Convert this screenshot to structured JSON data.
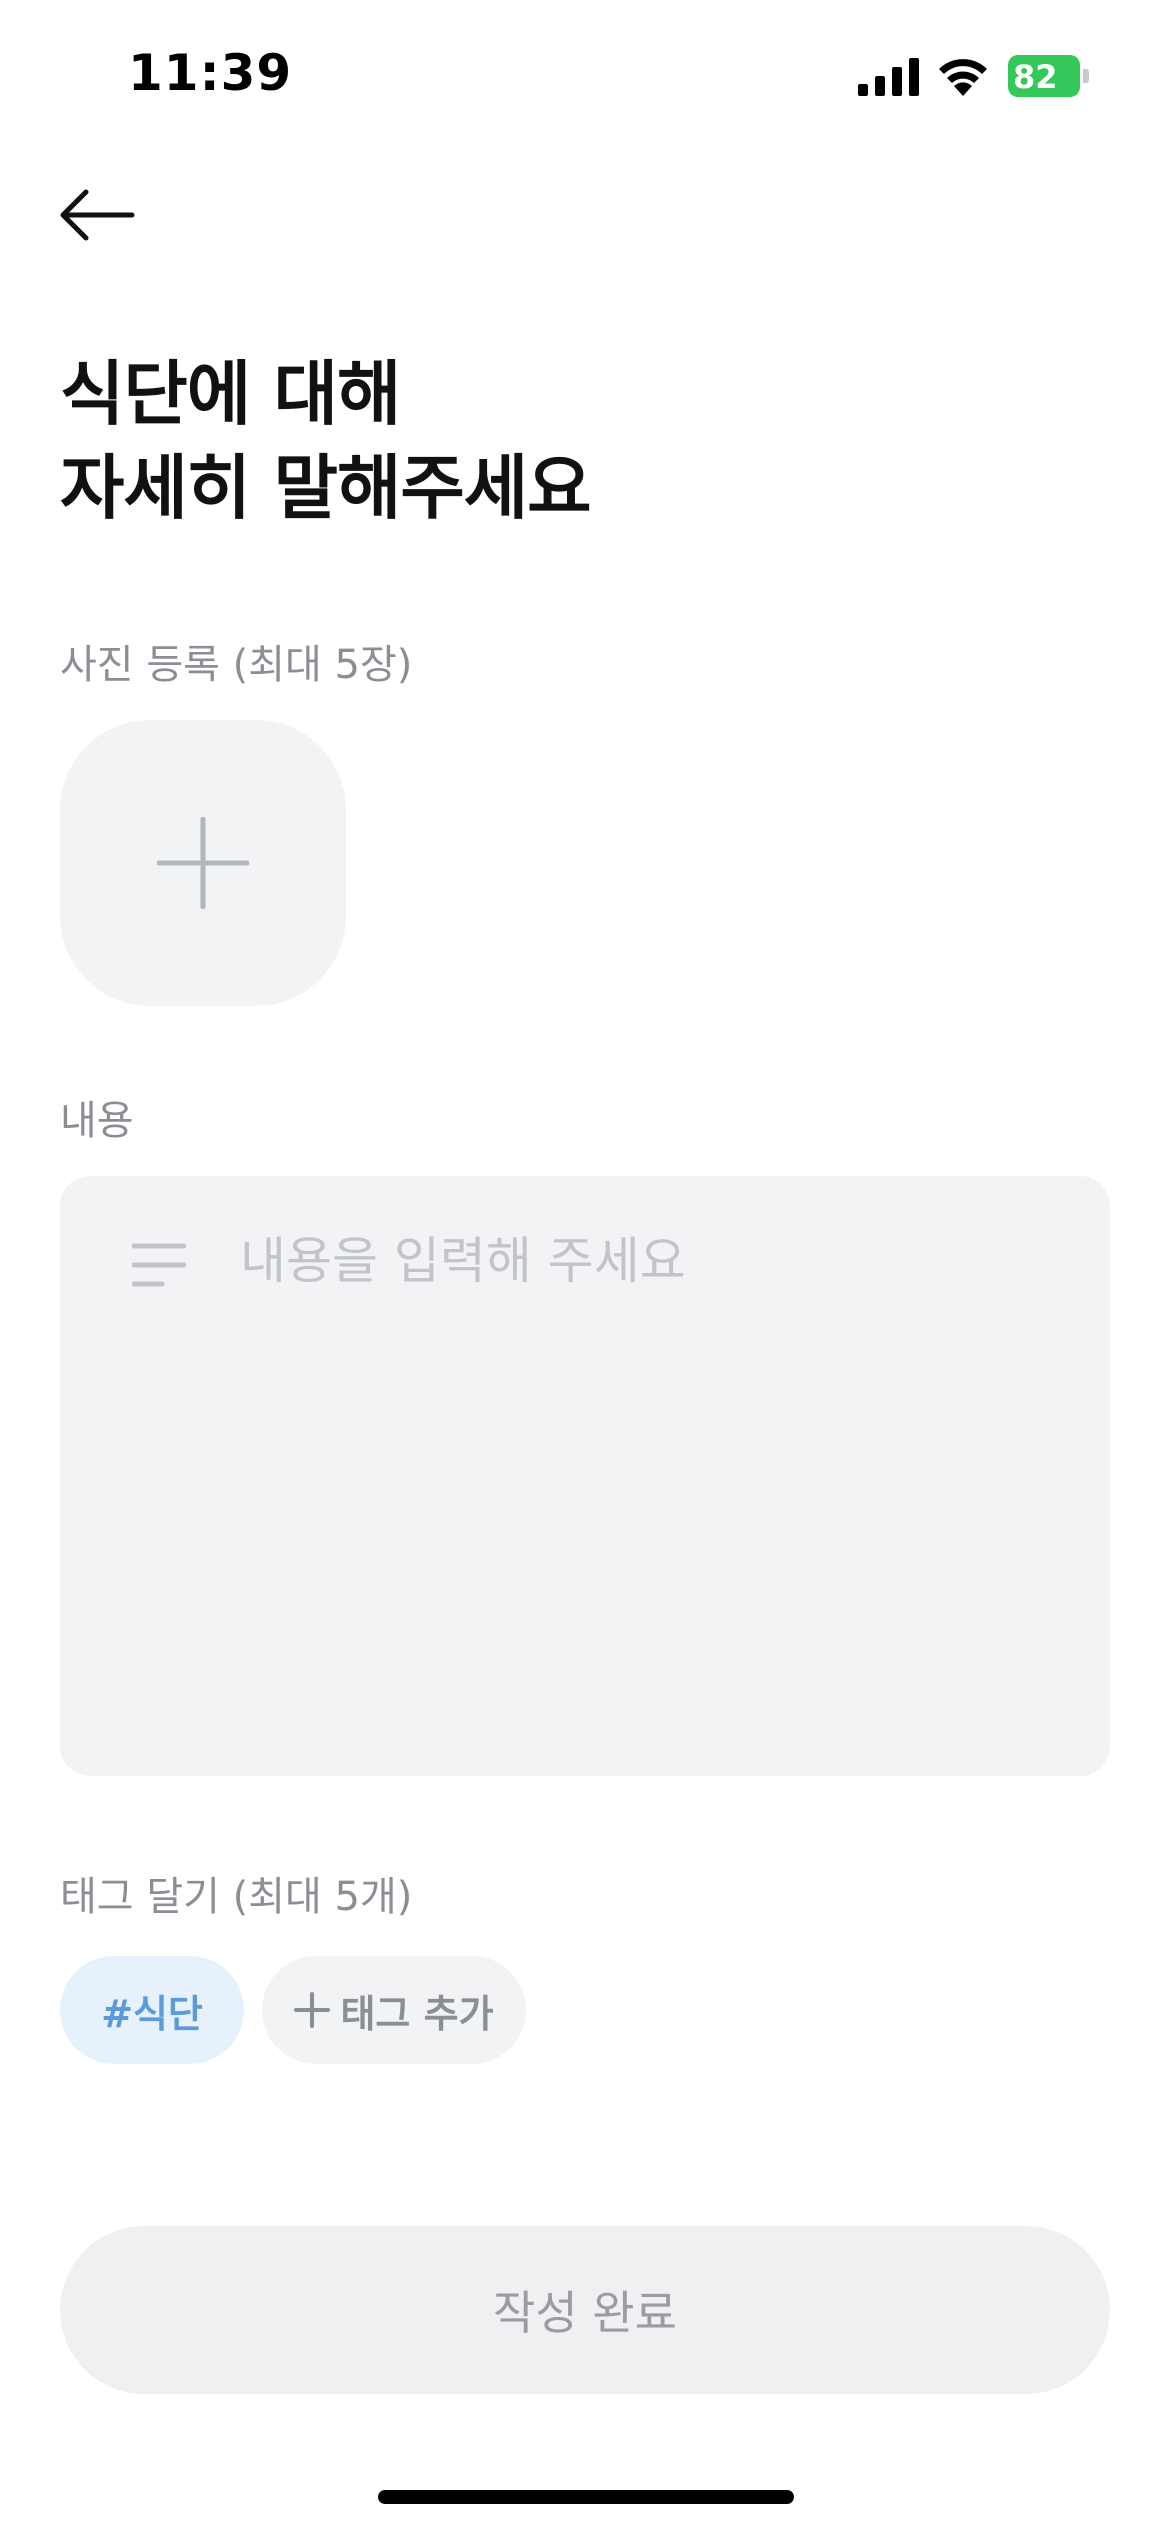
{
  "status_bar": {
    "time": "11:39",
    "battery_level": "82",
    "icons": [
      "signal-icon",
      "wifi-icon",
      "battery-charging-icon"
    ],
    "battery_color": "#34c759"
  },
  "header": {
    "back_icon": "arrow-left-icon"
  },
  "title": {
    "line1": "식단에 대해",
    "line2": "자세히 말해주세요"
  },
  "photo_section": {
    "label": "사진 등록 (최대 5장)",
    "add_icon": "plus-icon"
  },
  "content_section": {
    "label": "내용",
    "placeholder": "내용을 입력해 주세요",
    "value": "",
    "icon": "text-lines-icon"
  },
  "tags_section": {
    "label": "태그 달기 (최대 5개)",
    "tags": [
      "#식단"
    ],
    "add_tag_label": "태그 추가",
    "tag_color": "#5b9bd8",
    "tag_bg": "#e7f1fb"
  },
  "submit": {
    "label": "작성 완료"
  }
}
